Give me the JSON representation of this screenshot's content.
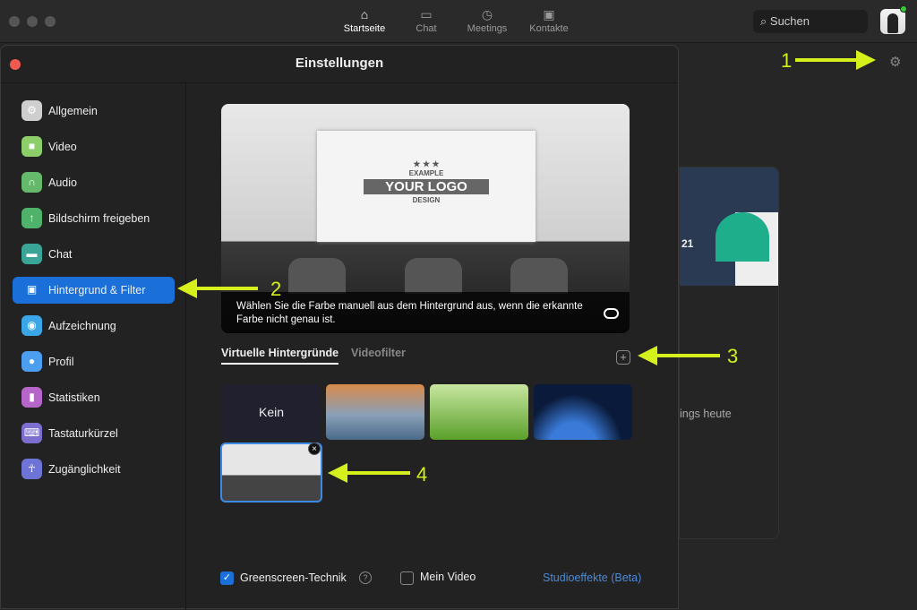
{
  "topbar": {
    "nav": [
      {
        "label": "Startseite",
        "icon": "home-icon"
      },
      {
        "label": "Chat",
        "icon": "chat-icon"
      },
      {
        "label": "Meetings",
        "icon": "clock-icon"
      },
      {
        "label": "Kontakte",
        "icon": "contacts-icon"
      }
    ],
    "search_placeholder": "Suchen"
  },
  "background": {
    "card_date": "21",
    "meetings_text": "ings heute"
  },
  "settings": {
    "title": "Einstellungen",
    "sidebar": [
      {
        "label": "Allgemein",
        "color": "#cfcfcf"
      },
      {
        "label": "Video",
        "color": "#8ccf6a"
      },
      {
        "label": "Audio",
        "color": "#64b96a"
      },
      {
        "label": "Bildschirm freigeben",
        "color": "#4fb26b"
      },
      {
        "label": "Chat",
        "color": "#3aa597"
      },
      {
        "label": "Hintergrund & Filter",
        "color": "#1a6fd8",
        "active": true
      },
      {
        "label": "Aufzeichnung",
        "color": "#3aa6e8"
      },
      {
        "label": "Profil",
        "color": "#4b9ef0"
      },
      {
        "label": "Statistiken",
        "color": "#b665c9"
      },
      {
        "label": "Tastaturkürzel",
        "color": "#7d6fd0"
      },
      {
        "label": "Zugänglichkeit",
        "color": "#6d74d6"
      }
    ],
    "preview": {
      "logo_top": "EXAMPLE",
      "logo_main": "YOUR LOGO",
      "logo_bottom": "DESIGN",
      "hint": "Wählen Sie die Farbe manuell aus dem Hintergrund aus, wenn die erkannte Farbe nicht genau ist."
    },
    "tabs": [
      {
        "label": "Virtuelle Hintergründe",
        "active": true
      },
      {
        "label": "Videofilter"
      }
    ],
    "thumbs": {
      "none_label": "Kein"
    },
    "options": {
      "greenscreen": "Greenscreen-Technik",
      "greenscreen_checked": true,
      "mirror": "Mein Video",
      "mirror_checked": false,
      "studio_link": "Studioeffekte (Beta)"
    }
  },
  "annotations": [
    "1",
    "2",
    "3",
    "4"
  ],
  "colors": {
    "accent": "#1a6fd8",
    "annotation": "#d5f01a"
  }
}
